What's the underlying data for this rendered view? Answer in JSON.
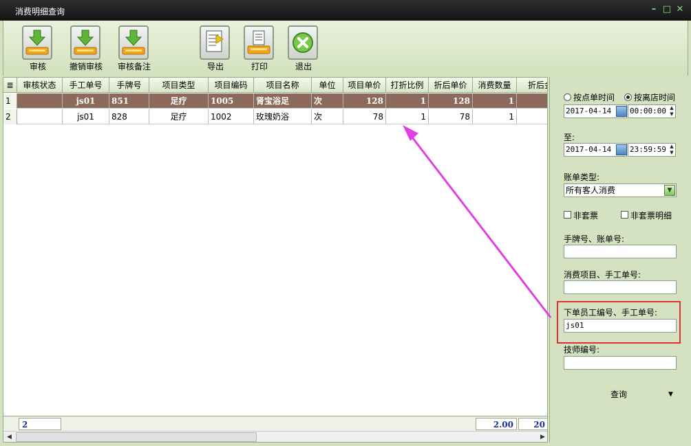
{
  "window": {
    "title": "消费明细查询",
    "controls": [
      "–",
      "□",
      "✕"
    ]
  },
  "toolbar": {
    "buttons": [
      {
        "label": "审核",
        "icon": "approve-icon"
      },
      {
        "label": "撤销审核",
        "icon": "revoke-approve-icon"
      },
      {
        "label": "审核备注",
        "icon": "approve-note-icon"
      },
      {
        "label": "导出",
        "icon": "export-icon"
      },
      {
        "label": "打印",
        "icon": "print-icon"
      },
      {
        "label": "退出",
        "icon": "exit-icon"
      }
    ]
  },
  "grid": {
    "columns": [
      "审核状态",
      "手工单号",
      "手牌号",
      "项目类型",
      "项目编码",
      "项目名称",
      "单位",
      "项目单价",
      "打折比例",
      "折后单价",
      "消费数量",
      "折后金"
    ],
    "rows": [
      {
        "num": "1",
        "cells": [
          "",
          "js01",
          "851",
          "足疗",
          "1005",
          "肾宝浴足",
          "次",
          "128",
          "1",
          "128",
          "1",
          ""
        ]
      },
      {
        "num": "2",
        "cells": [
          "",
          "js01",
          "828",
          "足疗",
          "1002",
          "玫瑰奶浴",
          "次",
          "78",
          "1",
          "78",
          "1",
          ""
        ]
      }
    ],
    "footer": {
      "count": "2",
      "quantity_total": "2.00",
      "amount_total": "20"
    }
  },
  "panel": {
    "radio_order_time": "按点单时间",
    "radio_leave_time": "按离店时间",
    "start_date": "2017-04-14",
    "start_time": "00:00:00",
    "to_label": "至:",
    "end_date": "2017-04-14",
    "end_time": "23:59:59",
    "bill_type_label": "账单类型:",
    "bill_type_value": "所有客人消费",
    "check_non_package": "非套票",
    "check_non_package_detail": "非套票明细",
    "card_bill_label": "手牌号、账单号:",
    "card_bill_value": "",
    "item_order_label": "消费项目、手工单号:",
    "item_order_value": "",
    "staff_order_label": "下单员工编号、手工单号:",
    "staff_order_value": "js01",
    "tech_label": "技师编号:",
    "tech_value": "",
    "query_label": "查询"
  },
  "colors": {
    "selected_row": "#8b6a5c",
    "highlight_box": "#e03030",
    "arrow": "#e040e0"
  }
}
